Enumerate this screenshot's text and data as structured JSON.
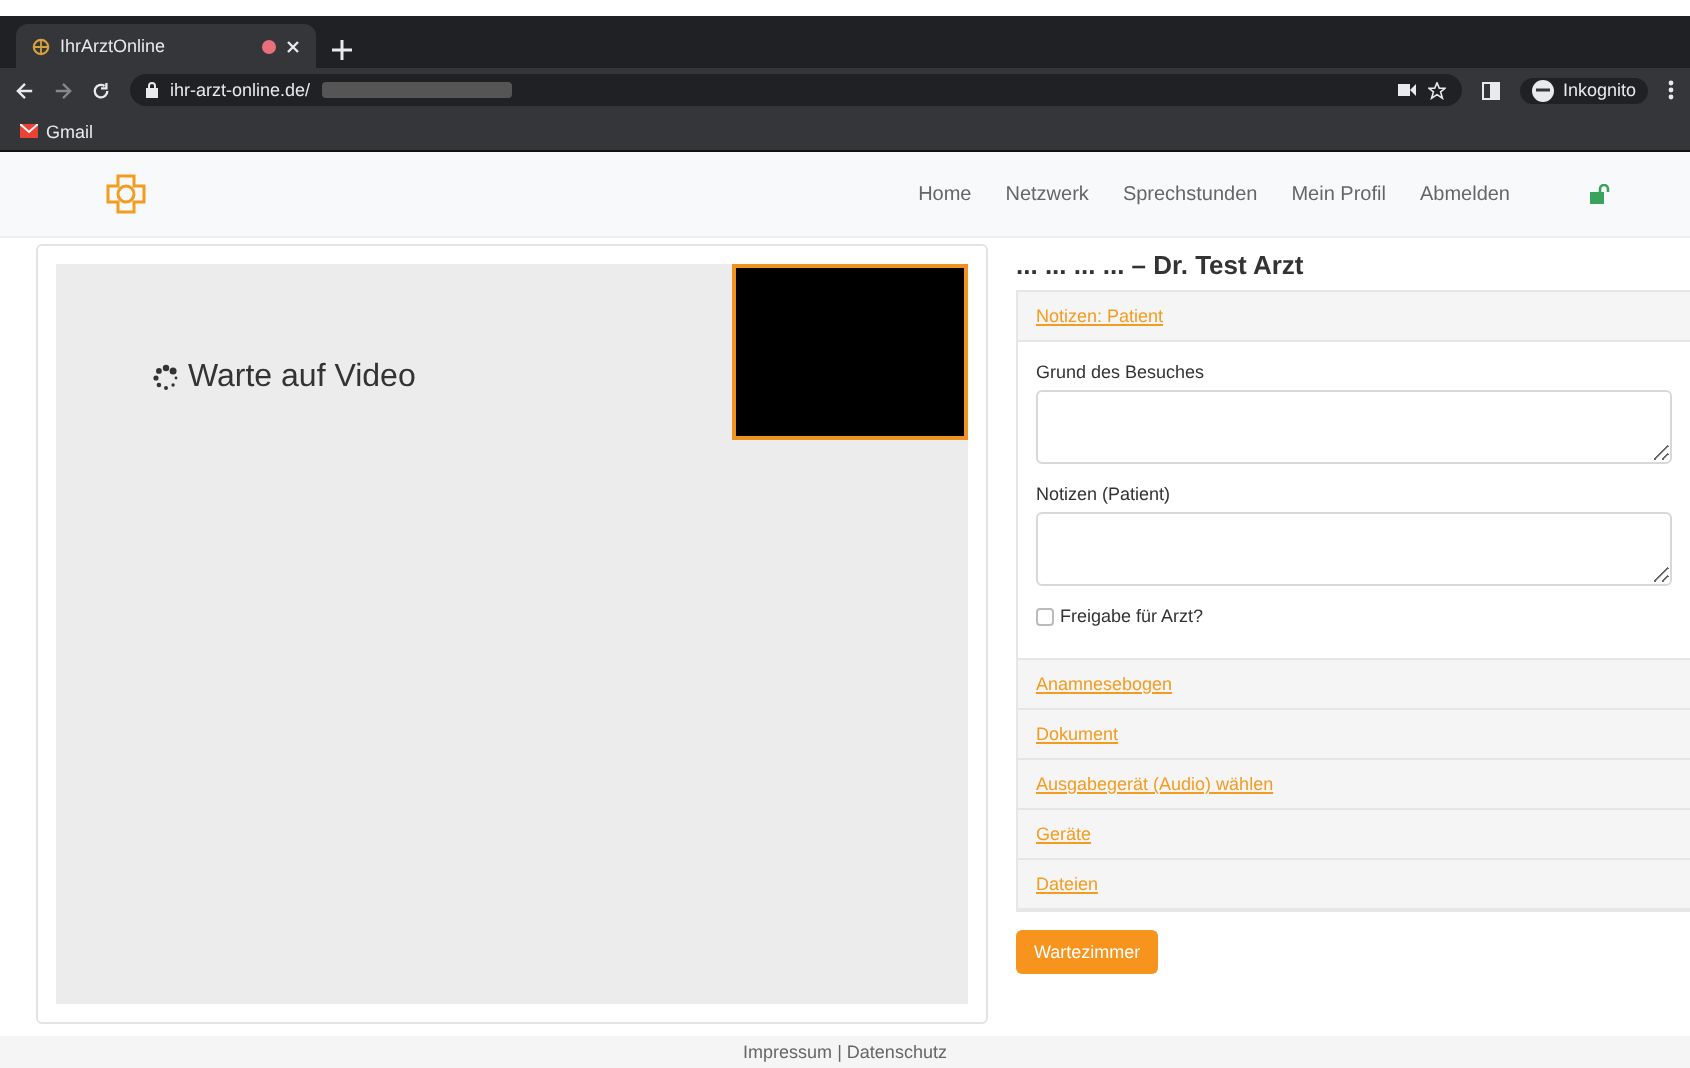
{
  "browser": {
    "tab_title": "IhrArztOnline",
    "url": "ihr-arzt-online.de/",
    "profile": "Inkognito",
    "bookmarks": [
      "Gmail"
    ]
  },
  "nav": {
    "items": [
      "Home",
      "Netzwerk",
      "Sprechstunden",
      "Mein Profil",
      "Abmelden"
    ]
  },
  "video": {
    "status": "Warte auf Video"
  },
  "panel": {
    "title": "... ... ... ... – Dr. Test Arzt",
    "sections": [
      {
        "kind": "form",
        "title": "Notizen: Patient",
        "fields": [
          {
            "label": "Grund des Besuches"
          },
          {
            "label": "Notizen (Patient)"
          }
        ],
        "checkbox": {
          "label": "Freigabe für Arzt?",
          "checked": false
        }
      },
      {
        "kind": "link",
        "title": "Anamnesebogen"
      },
      {
        "kind": "link",
        "title": "Dokument"
      },
      {
        "kind": "link",
        "title": "Ausgabegerät (Audio) wählen"
      },
      {
        "kind": "link",
        "title": "Geräte"
      },
      {
        "kind": "link",
        "title": "Dateien"
      }
    ],
    "button": "Wartezimmer"
  },
  "footer": {
    "links": [
      "Impressum",
      "Datenschutz"
    ],
    "separator": "|"
  }
}
